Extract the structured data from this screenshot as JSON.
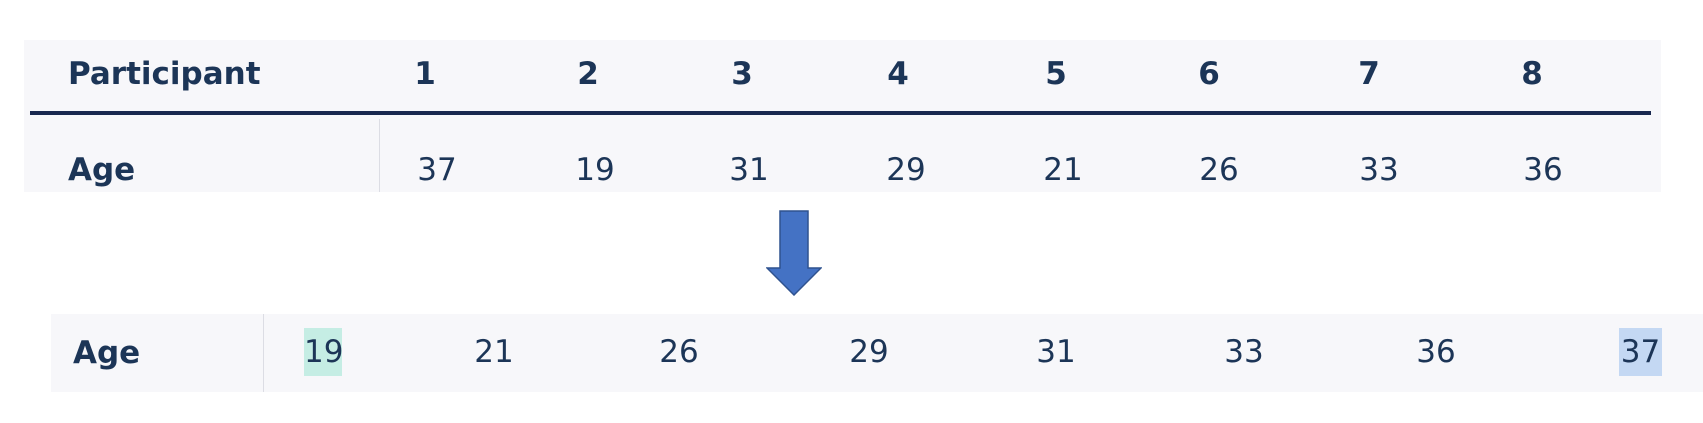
{
  "top_table": {
    "header_label": "Participant",
    "age_label": "Age",
    "participants": [
      "1",
      "2",
      "3",
      "4",
      "5",
      "6",
      "7",
      "8"
    ],
    "ages": [
      "37",
      "19",
      "31",
      "29",
      "21",
      "26",
      "33",
      "36"
    ]
  },
  "arrow": {
    "color": "#4472c4",
    "icon": "down-arrow-icon"
  },
  "sorted_row": {
    "label": "Age",
    "values": [
      "19",
      "21",
      "26",
      "29",
      "31",
      "33",
      "36",
      "37"
    ],
    "min_highlight_color": "#c5ede4",
    "max_highlight_color": "#c4d8f3"
  },
  "colors": {
    "text": "#1c3557",
    "rule": "#18284f",
    "panel_background": "#f7f7fa"
  }
}
